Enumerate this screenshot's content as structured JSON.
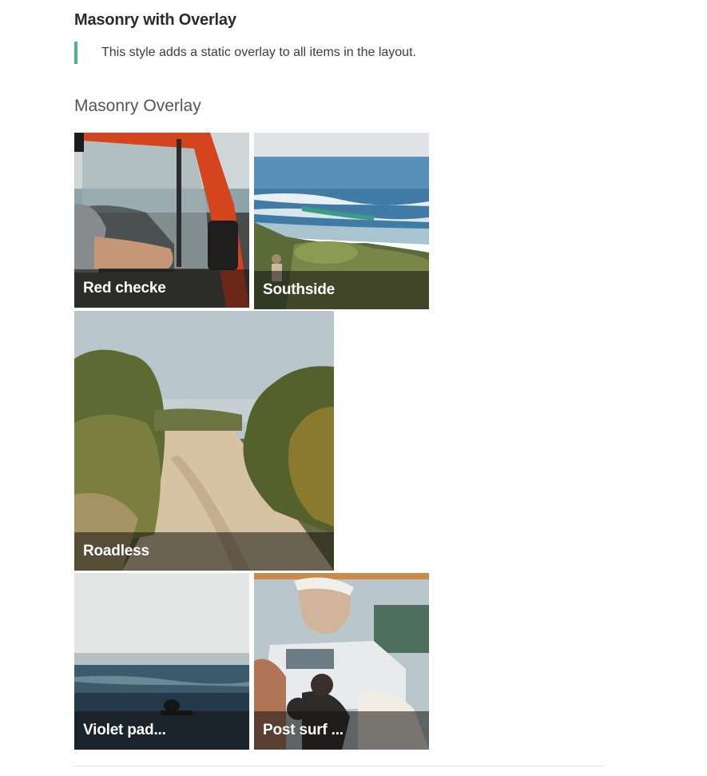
{
  "section": {
    "title": "Masonry with Overlay",
    "description": "This style adds a static overlay to all items in the layout."
  },
  "gallery": {
    "title": "Masonry Overlay",
    "items": [
      {
        "caption": "Red checke",
        "image": "red-car-window-photo"
      },
      {
        "caption": "Southside",
        "image": "coastal-surf-photo"
      },
      {
        "caption": "Roadless",
        "image": "sand-road-bushes-photo"
      },
      {
        "caption": "Violet pad...",
        "image": "surfer-in-ocean-photo"
      },
      {
        "caption": "Post surf ...",
        "image": "man-reflection-cars-photo"
      }
    ]
  },
  "colors": {
    "accent": "#4cb391",
    "overlay": "rgba(20,18,16,0.55)"
  }
}
